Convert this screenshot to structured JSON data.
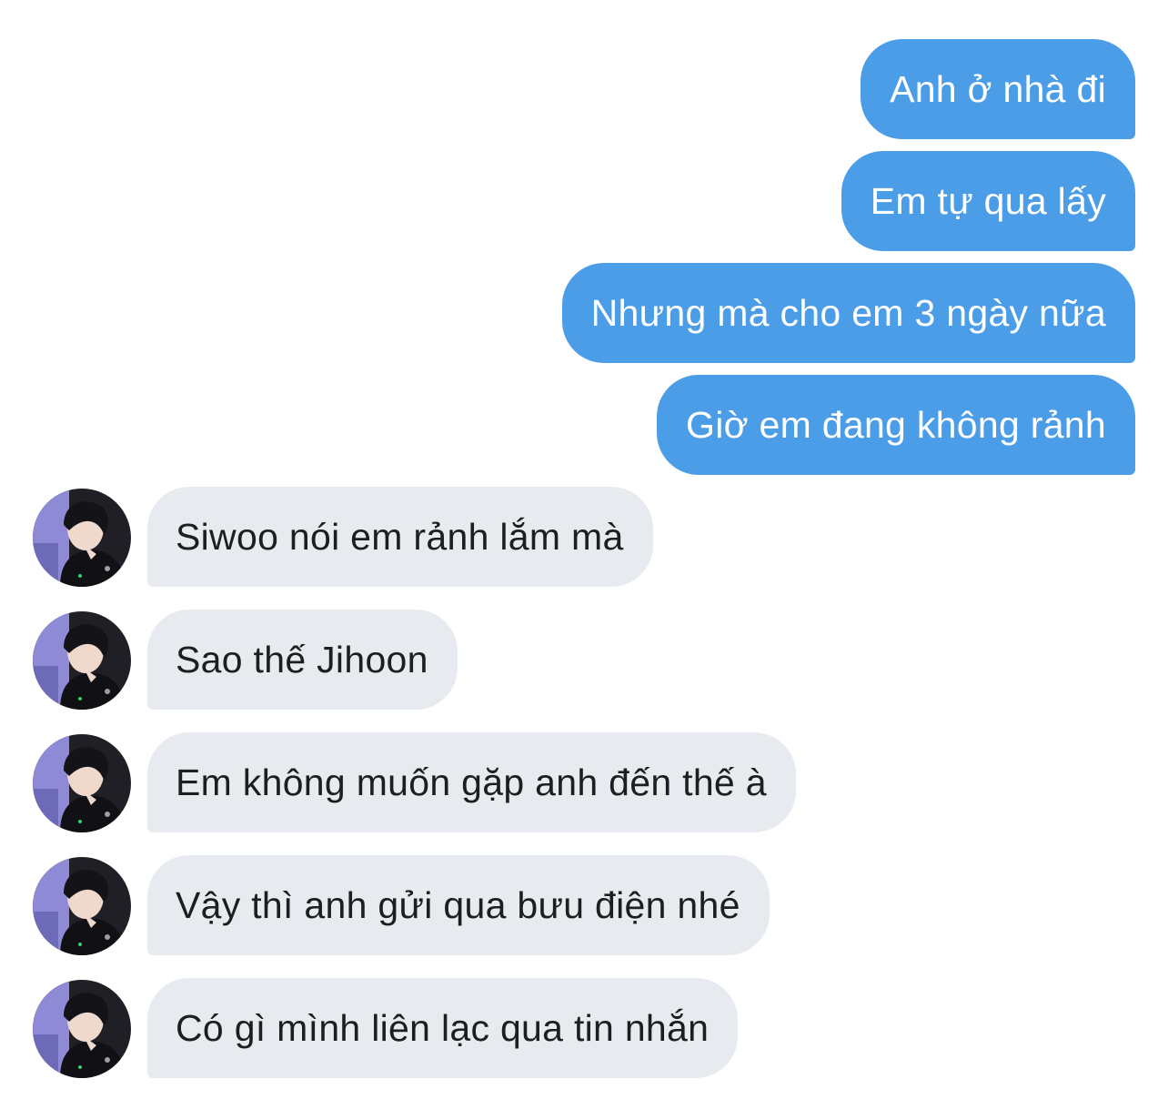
{
  "conversation": {
    "outgoing": [
      {
        "text": "Anh ở nhà đi"
      },
      {
        "text": "Em tự qua lấy"
      },
      {
        "text": "Nhưng mà cho em 3 ngày nữa"
      },
      {
        "text": "Giờ em đang không rảnh"
      }
    ],
    "incoming": [
      {
        "text": "Siwoo nói em rảnh lắm mà"
      },
      {
        "text": "Sao thế Jihoon"
      },
      {
        "text": "Em không muốn gặp anh đến thế à"
      },
      {
        "text": "Vậy thì anh gửi qua bưu điện nhé"
      },
      {
        "text": "Có gì mình liên lạc qua tin nhắn"
      }
    ]
  },
  "colors": {
    "outgoing_bubble": "#4c9de8",
    "incoming_bubble": "#e7ebef",
    "outgoing_text": "#ffffff",
    "incoming_text": "#1c1e21"
  }
}
